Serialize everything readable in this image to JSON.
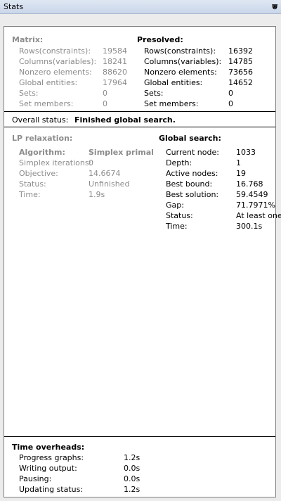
{
  "window": {
    "title": "Stats"
  },
  "matrix": {
    "heading": "Matrix:",
    "rows": [
      {
        "label": "Rows(constraints):",
        "value": "19584"
      },
      {
        "label": "Columns(variables):",
        "value": "18241"
      },
      {
        "label": "Nonzero elements:",
        "value": "88620"
      },
      {
        "label": "Global entities:",
        "value": "17964"
      },
      {
        "label": "Sets:",
        "value": "0"
      },
      {
        "label": "Set members:",
        "value": "0"
      }
    ]
  },
  "presolved": {
    "heading": "Presolved:",
    "rows": [
      {
        "label": "Rows(constraints):",
        "value": "16392"
      },
      {
        "label": "Columns(variables):",
        "value": "14785"
      },
      {
        "label": "Nonzero elements:",
        "value": "73656"
      },
      {
        "label": "Global entities:",
        "value": "14652"
      },
      {
        "label": "Sets:",
        "value": "0"
      },
      {
        "label": "Set members:",
        "value": "0"
      }
    ]
  },
  "overall": {
    "label": "Overall status:",
    "value": "Finished global search."
  },
  "lp": {
    "heading": "LP relaxation:",
    "algorithm_label": "Algorithm:",
    "algorithm_value": "Simplex primal",
    "rows": [
      {
        "label": "Simplex iterations:",
        "value": "0"
      },
      {
        "label": "Objective:",
        "value": "14.6674"
      },
      {
        "label": "Status:",
        "value": "Unfinished"
      },
      {
        "label": "Time:",
        "value": "1.9s"
      }
    ]
  },
  "global": {
    "heading": "Global search:",
    "rows": [
      {
        "label": "Current node:",
        "value": "1033"
      },
      {
        "label": "Depth:",
        "value": "1"
      },
      {
        "label": "Active nodes:",
        "value": "19"
      },
      {
        "label": "Best bound:",
        "value": "16.768"
      },
      {
        "label": "Best solution:",
        "value": "59.4549"
      },
      {
        "label": "Gap:",
        "value": "71.7971%"
      },
      {
        "label": "Status:",
        "value": "At least one"
      },
      {
        "label": "Time:",
        "value": "300.1s"
      }
    ]
  },
  "overheads": {
    "heading": "Time overheads:",
    "rows": [
      {
        "label": "Progress graphs:",
        "value": "1.2s"
      },
      {
        "label": "Writing output:",
        "value": "0.0s"
      },
      {
        "label": "Pausing:",
        "value": "0.0s"
      },
      {
        "label": "Updating status:",
        "value": "1.2s"
      }
    ]
  }
}
